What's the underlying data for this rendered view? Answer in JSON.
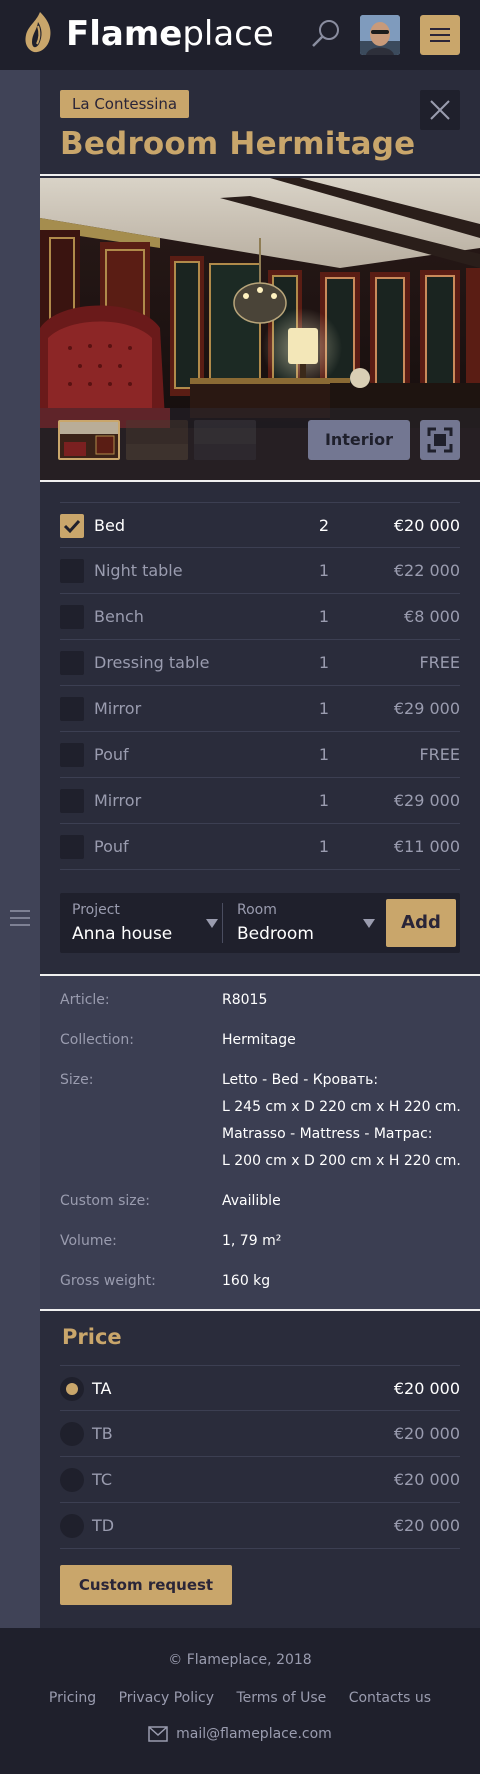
{
  "header": {
    "brand_bold": "Flame",
    "brand_light": "place",
    "colors": {
      "accent": "#c9a66b",
      "header_bg": "#1f202c",
      "page_bg": "#2a2c3b"
    }
  },
  "product": {
    "collection_badge": "La Contessina",
    "title": "Bedroom Hermitage",
    "gallery_mode_label": "Interior"
  },
  "items": [
    {
      "name": "Bed",
      "qty": "2",
      "price": "€20 000",
      "checked": true
    },
    {
      "name": "Night table",
      "qty": "1",
      "price": "€22 000",
      "checked": false
    },
    {
      "name": "Bench",
      "qty": "1",
      "price": "€8 000",
      "checked": false
    },
    {
      "name": "Dressing table",
      "qty": "1",
      "price": "FREE",
      "checked": false
    },
    {
      "name": "Mirror",
      "qty": "1",
      "price": "€29 000",
      "checked": false
    },
    {
      "name": "Pouf",
      "qty": "1",
      "price": "FREE",
      "checked": false
    },
    {
      "name": "Mirror",
      "qty": "1",
      "price": "€29 000",
      "checked": false
    },
    {
      "name": "Pouf",
      "qty": "1",
      "price": "€11 000",
      "checked": false
    }
  ],
  "selector": {
    "project_label": "Project",
    "project_value": "Anna house",
    "room_label": "Room",
    "room_value": "Bedroom",
    "add_label": "Add"
  },
  "specs": {
    "article": {
      "k": "Article:",
      "v": "R8015"
    },
    "collection": {
      "k": "Collection:",
      "v": "Hermitage"
    },
    "size": {
      "k": "Size:",
      "v1": "Letto - Bed - Кровать:",
      "v2": "L 245 cm x D 220 cm x H 220 cm.",
      "v3": "Matrasso - Mattress - Матрас:",
      "v4": "L 200 cm x D 200 cm x H 220 cm."
    },
    "custom_size": {
      "k": "Custom size:",
      "v": "Availible"
    },
    "volume": {
      "k": "Volume:",
      "v": "1, 79 m²"
    },
    "gross_weight": {
      "k": "Gross weight:",
      "v": "160 kg"
    }
  },
  "price": {
    "title": "Price",
    "options": [
      {
        "name": "TA",
        "value": "€20 000",
        "selected": true
      },
      {
        "name": "TB",
        "value": "€20 000",
        "selected": false
      },
      {
        "name": "TC",
        "value": "€20 000",
        "selected": false
      },
      {
        "name": "TD",
        "value": "€20 000",
        "selected": false
      }
    ],
    "custom_request_label": "Custom request"
  },
  "footer": {
    "copyright": "© Flameplace, 2018",
    "links": [
      "Pricing",
      "Privacy Policy",
      "Terms of Use",
      "Contacts us"
    ],
    "email": "mail@flameplace.com"
  }
}
